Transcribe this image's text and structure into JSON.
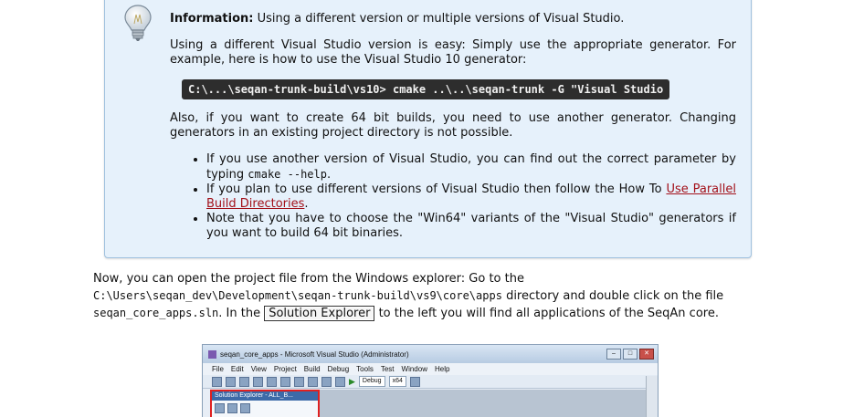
{
  "info_box": {
    "title": "Information:",
    "subtitle": " Using a different version or multiple versions of Visual Studio.",
    "para1": "Using a different Visual Studio version is easy: Simply use the appropriate generator. For example, here is how to use the Visual Studio 10 generator:",
    "command": "C:\\...\\seqan-trunk-build\\vs10> cmake ..\\..\\seqan-trunk -G \"Visual Studio",
    "para2": "Also, if you want to create 64 bit builds, you need to use another generator. Changing generators in an existing project directory is not possible.",
    "bullets": {
      "b1_pre": "If you use another version of Visual Studio, you can find out the correct parameter by typing ",
      "b1_code": "cmake --help",
      "b1_post": ".",
      "b2_pre": "If you plan to use different versions of Visual Studio then follow the How To ",
      "b2_link": "Use Parallel Build Directories",
      "b2_post": ".",
      "b3": "Note that you have to choose the \"Win64\" variants of the \"Visual Studio\" generators if you want to build 64 bit binaries."
    }
  },
  "main": {
    "p1": "Now, you can open the project file from the Windows explorer: Go to the ",
    "path": "C:\\Users\\seqan_dev\\Development\\seqan-trunk-build\\vs9\\core\\apps",
    "p2": " directory and double click on the file ",
    "file": "seqan_core_apps.sln",
    "p3": ". In the ",
    "gui_label": "Solution Explorer",
    "p4": " to the left you will find all applications of the SeqAn core."
  },
  "screenshot": {
    "window_title": "seqan_core_apps - Microsoft Visual Studio (Administrator)",
    "menu": [
      "File",
      "Edit",
      "View",
      "Project",
      "Build",
      "Debug",
      "Tools",
      "Test",
      "Window",
      "Help"
    ],
    "config": "Debug",
    "platform": "x64",
    "solution_explorer_title": "Solution Explorer - ALL_B..."
  }
}
